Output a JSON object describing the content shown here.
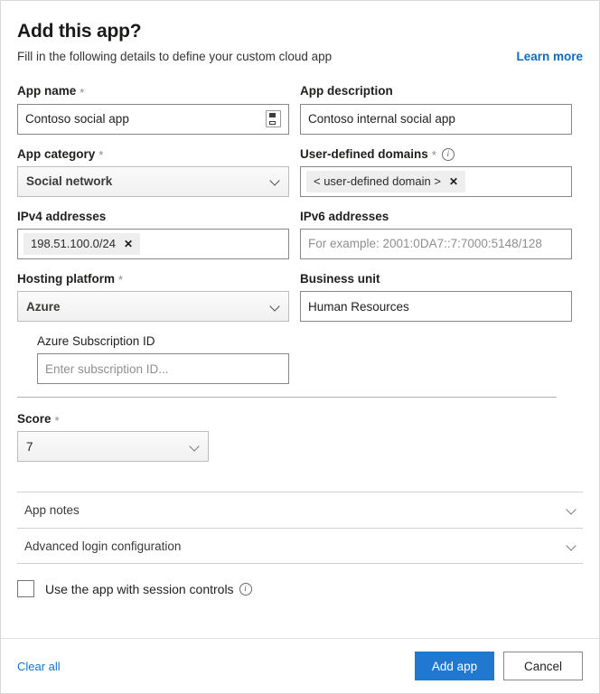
{
  "header": {
    "title": "Add this app?",
    "subtitle": "Fill in the following details to define your custom cloud app",
    "learn_more": "Learn more"
  },
  "fields": {
    "app_name": {
      "label": "App name",
      "required": "*",
      "value": "Contoso social app",
      "icon": "picker-icon"
    },
    "app_description": {
      "label": "App description",
      "value": "Contoso internal social app"
    },
    "app_category": {
      "label": "App category",
      "required": "*",
      "value": "Social network"
    },
    "user_defined_domains": {
      "label": "User-defined domains",
      "required": "*",
      "info": "i",
      "chip": "< user-defined domain >",
      "chip_remove": "✕"
    },
    "ipv4": {
      "label": "IPv4 addresses",
      "chip": "198.51.100.0/24",
      "chip_remove": "✕"
    },
    "ipv6": {
      "label": "IPv6 addresses",
      "placeholder": "For example: 2001:0DA7::7:7000:5148/128"
    },
    "hosting_platform": {
      "label": "Hosting platform",
      "required": "*",
      "value": "Azure"
    },
    "business_unit": {
      "label": "Business unit",
      "value": "Human Resources"
    },
    "azure_subscription_id": {
      "label": "Azure Subscription ID",
      "placeholder": "Enter subscription ID..."
    },
    "score": {
      "label": "Score",
      "required": "*",
      "value": "7"
    }
  },
  "accordions": [
    {
      "label": "App notes",
      "icon": "chevron-down-icon"
    },
    {
      "label": "Advanced login configuration",
      "icon": "chevron-down-icon"
    }
  ],
  "session_controls": {
    "label": "Use the app with session controls",
    "info": "i",
    "checked": false
  },
  "footer": {
    "clear_all": "Clear all",
    "primary": "Add app",
    "secondary": "Cancel"
  },
  "colors": {
    "primary_blue": "#2178d1",
    "link_blue": "#0f6cbd",
    "clear_link_blue": "#1a73c7",
    "chip_bg": "#eeeeee",
    "border": "#8a8886"
  }
}
